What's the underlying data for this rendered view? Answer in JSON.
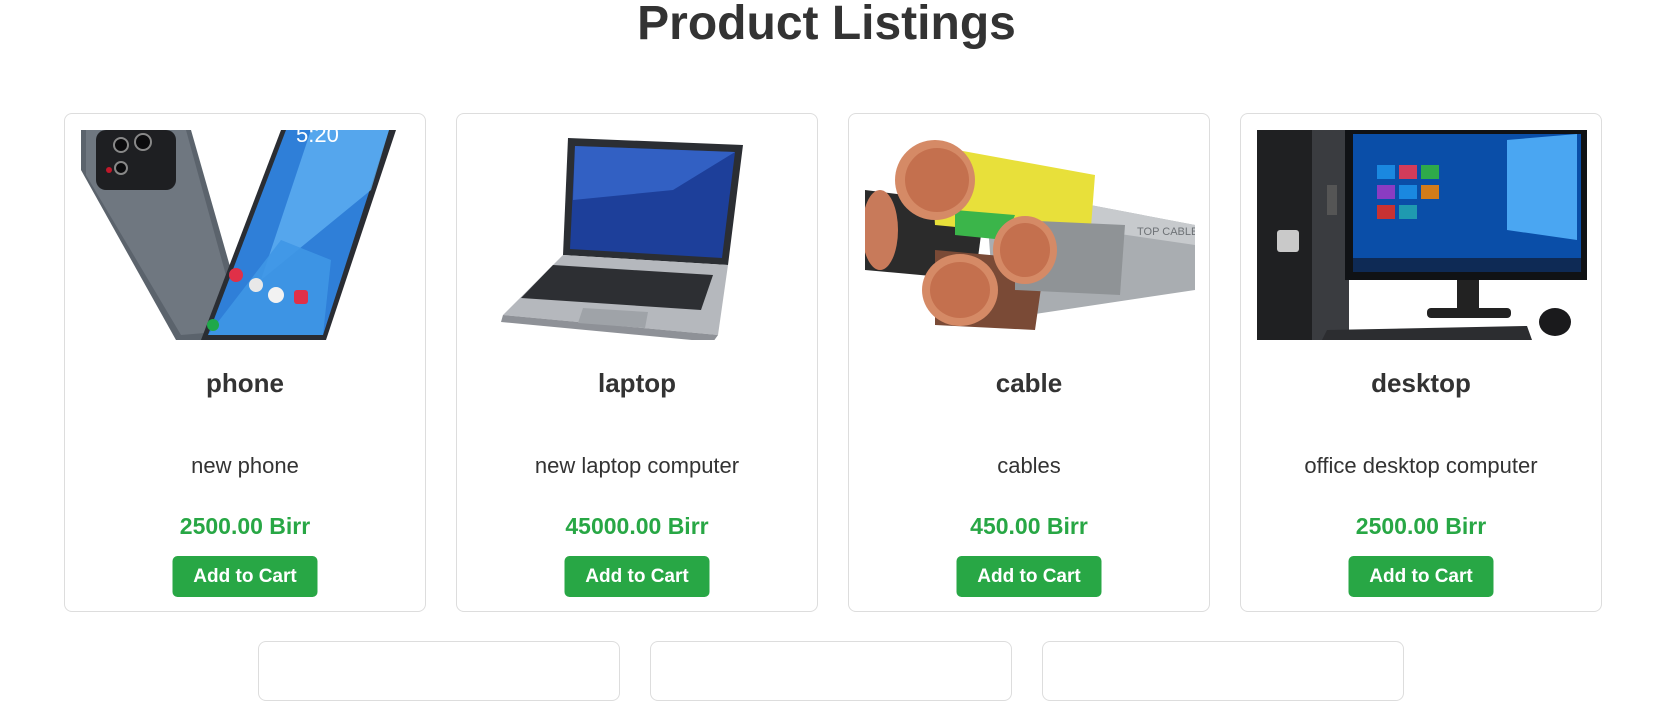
{
  "page": {
    "title": "Product Listings"
  },
  "colors": {
    "price": "#28a745",
    "button_bg": "#28a745",
    "button_text": "#ffffff",
    "card_border": "#dddddd"
  },
  "products": [
    {
      "name": "phone",
      "description": "new phone",
      "price": "2500.00 Birr",
      "button_label": "Add to Cart",
      "image": "phone-photo"
    },
    {
      "name": "laptop",
      "description": "new laptop computer",
      "price": "45000.00 Birr",
      "button_label": "Add to Cart",
      "image": "laptop-photo"
    },
    {
      "name": "cable",
      "description": "cables",
      "price": "450.00 Birr",
      "button_label": "Add to Cart",
      "image": "cable-photo"
    },
    {
      "name": "desktop",
      "description": "office desktop computer",
      "price": "2500.00 Birr",
      "button_label": "Add to Cart",
      "image": "desktop-photo"
    }
  ]
}
